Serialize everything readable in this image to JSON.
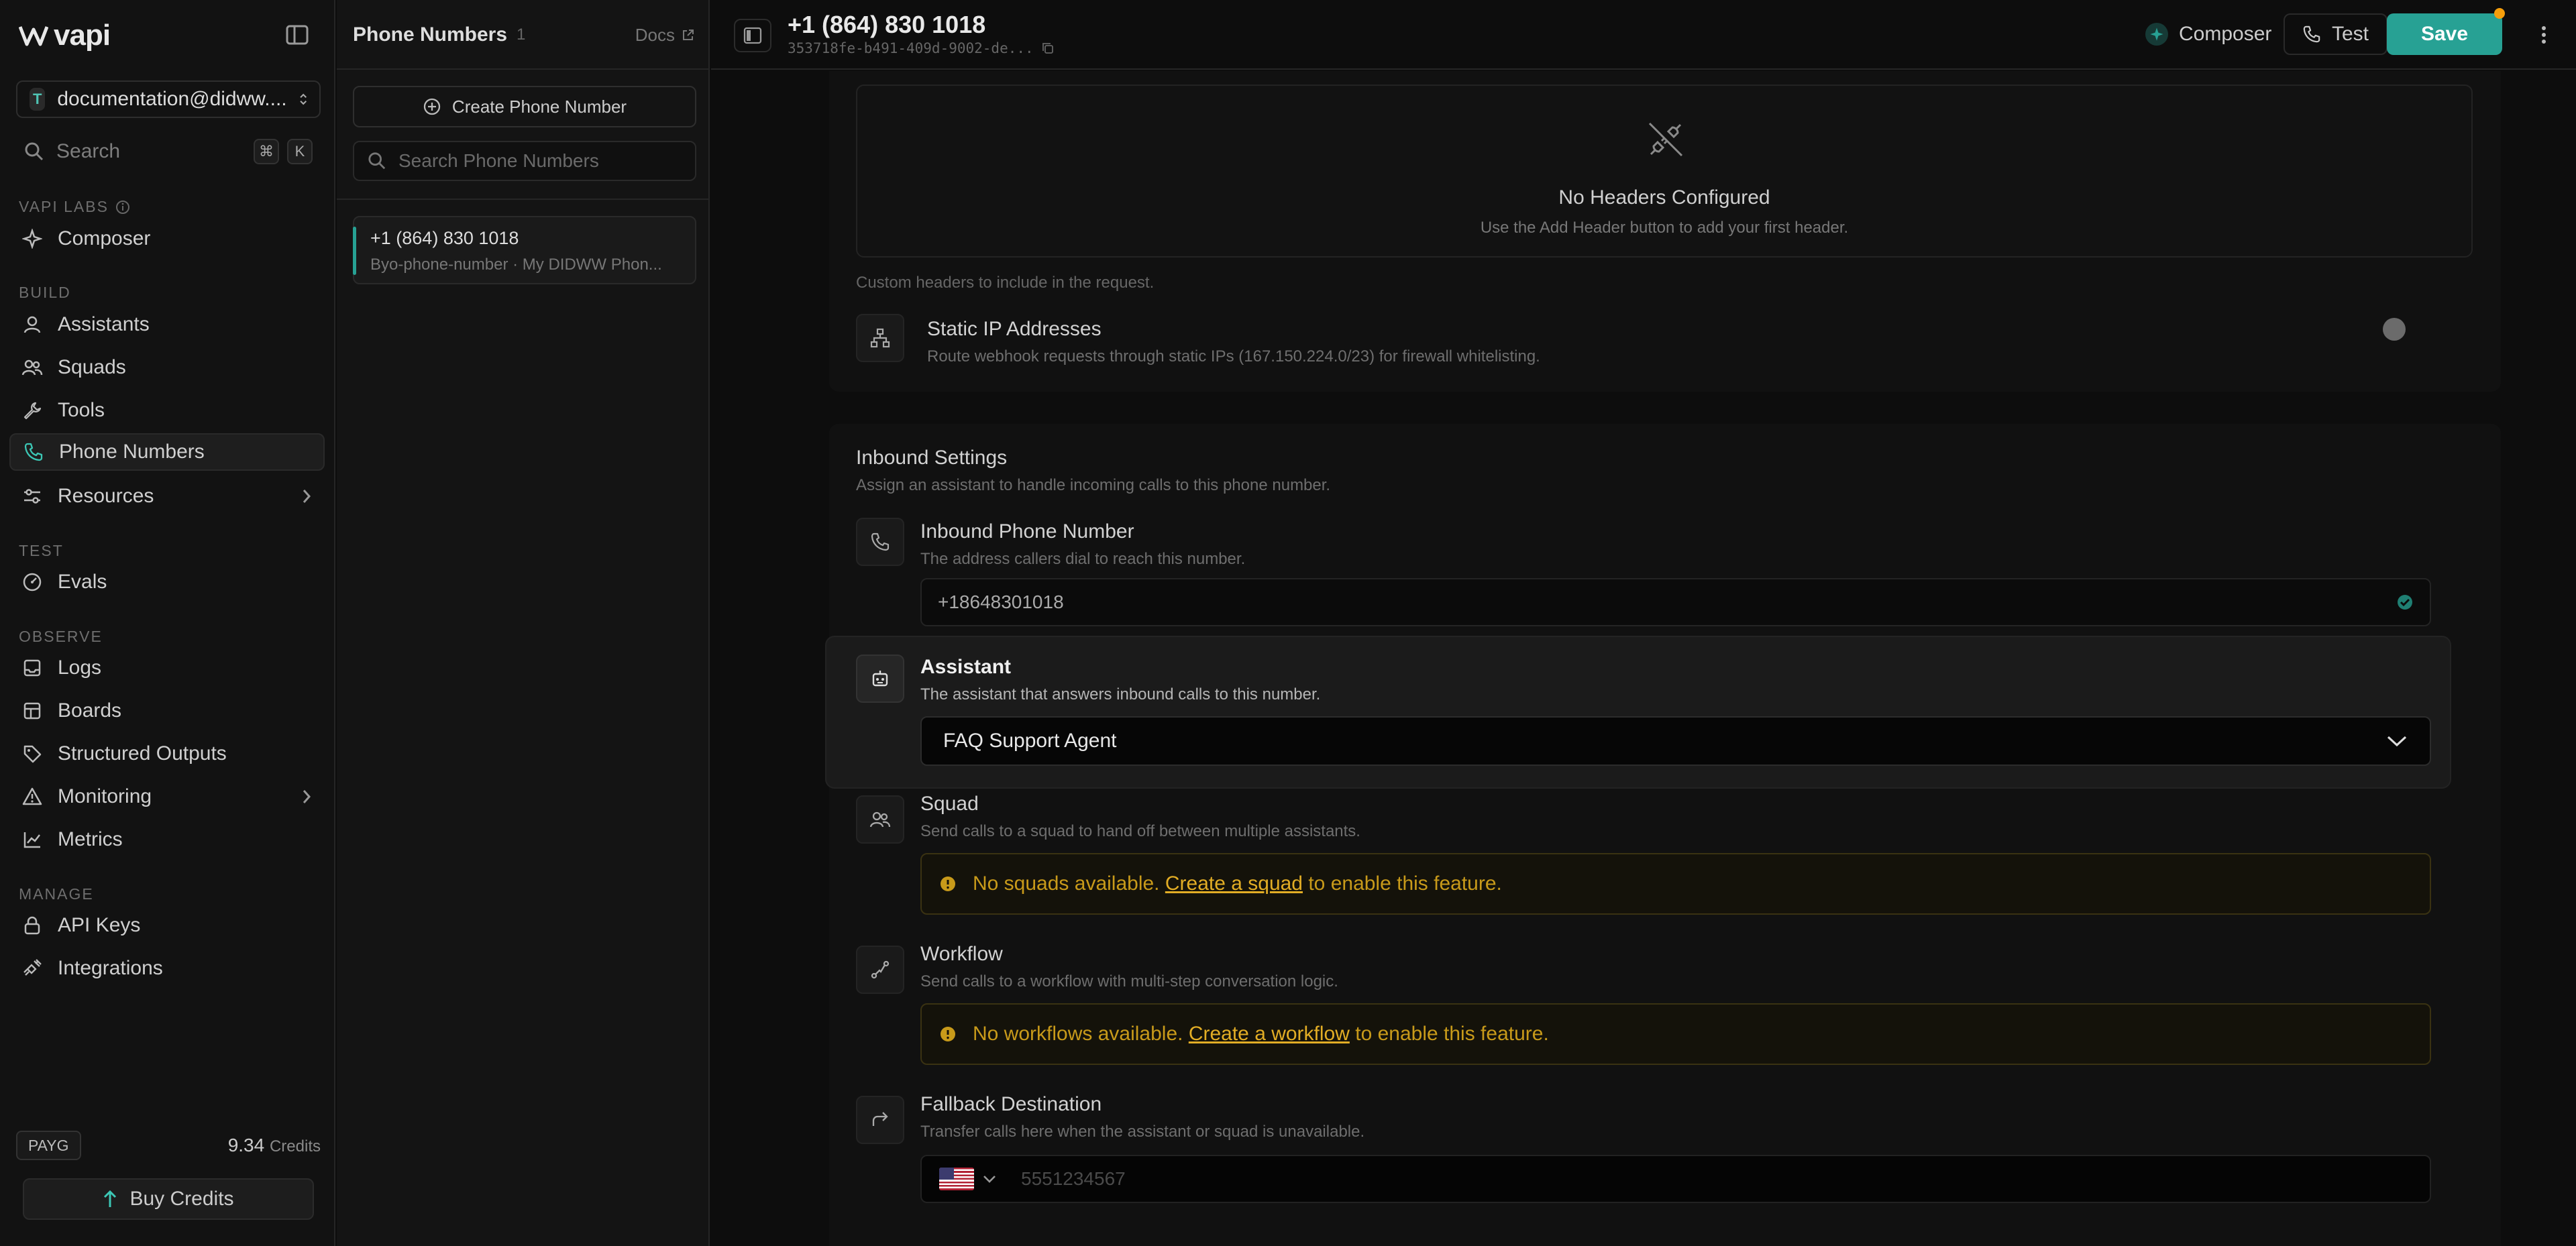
{
  "app": {
    "logo_text": "vapi"
  },
  "sidebar": {
    "org_initial": "T",
    "org_name": "documentation@didww....",
    "search_placeholder": "Search",
    "kbd_cmd": "⌘",
    "kbd_key": "K",
    "sections": {
      "labs": "VAPI LABS",
      "build": "BUILD",
      "test": "TEST",
      "observe": "OBSERVE",
      "manage": "MANAGE"
    },
    "items": {
      "composer": "Composer",
      "assistants": "Assistants",
      "squads": "Squads",
      "tools": "Tools",
      "phone_numbers": "Phone Numbers",
      "resources": "Resources",
      "evals": "Evals",
      "logs": "Logs",
      "boards": "Boards",
      "structured_outputs": "Structured Outputs",
      "monitoring": "Monitoring",
      "metrics": "Metrics",
      "api_keys": "API Keys",
      "integrations": "Integrations"
    },
    "plan": "PAYG",
    "credits_value": "9.34",
    "credits_label": "Credits",
    "buy_label": "Buy Credits"
  },
  "list_panel": {
    "title": "Phone Numbers",
    "count": "1",
    "docs_label": "Docs",
    "create_label": "Create Phone Number",
    "search_placeholder": "Search Phone Numbers",
    "items": [
      {
        "number": "+1 (864) 830 1018",
        "subtitle": "Byo-phone-number · My DIDWW Phon..."
      }
    ]
  },
  "topbar": {
    "title": "+1 (864) 830 1018",
    "id": "353718fe-b491-409d-9002-de...",
    "composer_label": "Composer",
    "test_label": "Test",
    "save_label": "Save"
  },
  "headers": {
    "empty_title": "No Headers Configured",
    "empty_subtitle": "Use the Add Header button to add your first header.",
    "hint": "Custom headers to include in the request."
  },
  "static_ip": {
    "title": "Static IP Addresses",
    "subtitle": "Route webhook requests through static IPs (167.150.224.0/23) for firewall whitelisting."
  },
  "inbound": {
    "title": "Inbound Settings",
    "subtitle": "Assign an assistant to handle incoming calls to this phone number.",
    "phone_title": "Inbound Phone Number",
    "phone_subtitle": "The address callers dial to reach this number.",
    "phone_value": "+18648301018",
    "assistant_title": "Assistant",
    "assistant_subtitle": "The assistant that answers inbound calls to this number.",
    "assistant_value": "FAQ Support Agent",
    "squad_title": "Squad",
    "squad_subtitle": "Send calls to a squad to hand off between multiple assistants.",
    "squad_warn_pre": "No squads available.",
    "squad_warn_link": "Create a squad",
    "squad_warn_post": "to enable this feature.",
    "workflow_title": "Workflow",
    "workflow_subtitle": "Send calls to a workflow with multi-step conversation logic.",
    "workflow_warn_pre": "No workflows available.",
    "workflow_warn_link": "Create a workflow",
    "workflow_warn_post": "to enable this feature.",
    "fallback_title": "Fallback Destination",
    "fallback_subtitle": "Transfer calls here when the assistant or squad is unavailable.",
    "fallback_placeholder": "5551234567"
  },
  "colors": {
    "accent": "#27a194",
    "warning": "#d4a017",
    "save_dot": "#f59e0b"
  }
}
